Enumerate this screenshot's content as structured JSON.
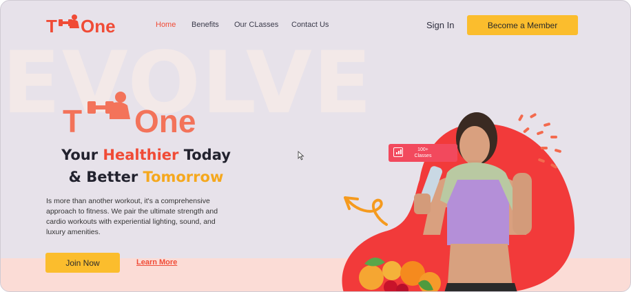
{
  "brand": {
    "logo_t": "T",
    "logo_one": "One"
  },
  "nav": {
    "items": [
      "Home",
      "Benefits",
      "Our CLasses",
      "Contact Us"
    ],
    "active": "Home",
    "sign_in": "Sign In",
    "become_member": "Become a Member"
  },
  "hero": {
    "watermark": "EVOLVE",
    "logo_t": "T",
    "logo_one": "One",
    "headline_line1_a": "Your ",
    "headline_line1_b": "Healthier",
    "headline_line1_c": " Today",
    "headline_line2_a": "& Better ",
    "headline_line2_b": "Tomorrow",
    "description": "Is more than another workout, it's a comprehensive approach to fitness. We pair the ultimate strength and cardio workouts with experiential lighting, sound, and luxury amenities.",
    "join_label": "Join Now",
    "learn_label": "Learn More"
  },
  "badge": {
    "line1": "100+",
    "line2": "Classes",
    "icon": "chart-monitor-icon"
  },
  "colors": {
    "accent_red": "#f04b36",
    "accent_yellow": "#fbbd2d",
    "background": "#e7e2ea",
    "band": "#fbdcd6",
    "badge": "#f2495d"
  }
}
